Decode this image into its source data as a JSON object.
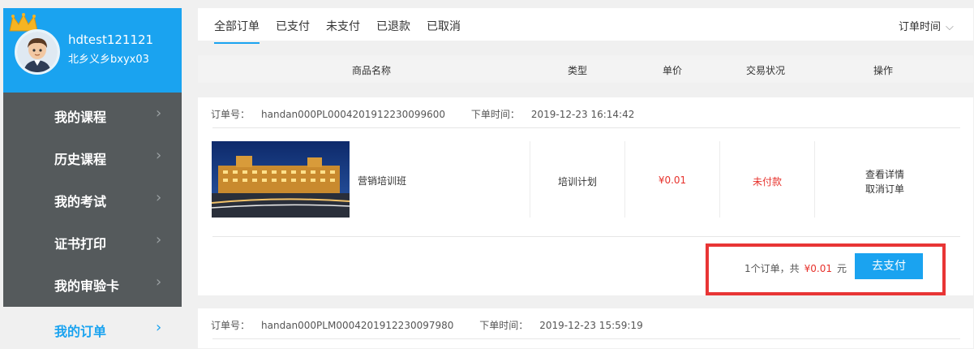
{
  "user": {
    "username": "hdtest121121",
    "dept": "北乡义乡bxyx03"
  },
  "sidebar": {
    "items": [
      {
        "label": "我的课程"
      },
      {
        "label": "历史课程"
      },
      {
        "label": "我的考试"
      },
      {
        "label": "证书打印"
      },
      {
        "label": "我的审验卡"
      }
    ],
    "active": {
      "label": "我的订单"
    },
    "chevron": "›"
  },
  "tabs": [
    "全部订单",
    "已支付",
    "未支付",
    "已退款",
    "已取消"
  ],
  "sort": {
    "label": "订单时间",
    "chevron": "⌵"
  },
  "table_headers": {
    "name": "商品名称",
    "type": "类型",
    "price": "单价",
    "status": "交易状况",
    "action": "操作"
  },
  "orders": [
    {
      "order_no_label": "订单号：",
      "order_no": "handan000PL0004201912230099600",
      "time_label": "下单时间：",
      "time": "2019-12-23 16:14:42",
      "product_name": "营销培训班",
      "type": "培训计划",
      "price": "¥0.01",
      "status": "未付款",
      "action_detail": "查看详情",
      "action_cancel": "取消订单",
      "summary_prefix": "1个订单，共",
      "summary_amount": "¥0.01",
      "summary_unit": "元",
      "pay_button": "去支付"
    },
    {
      "order_no_label": "订单号：",
      "order_no": "handan000PLM0004201912230097980",
      "time_label": "下单时间：",
      "time": "2019-12-23 15:59:19"
    }
  ],
  "colors": {
    "accent": "#1aa3f0",
    "sidebar_bg": "#555a5c",
    "price_red": "#e7322c",
    "highlight_box": "#e83535"
  }
}
